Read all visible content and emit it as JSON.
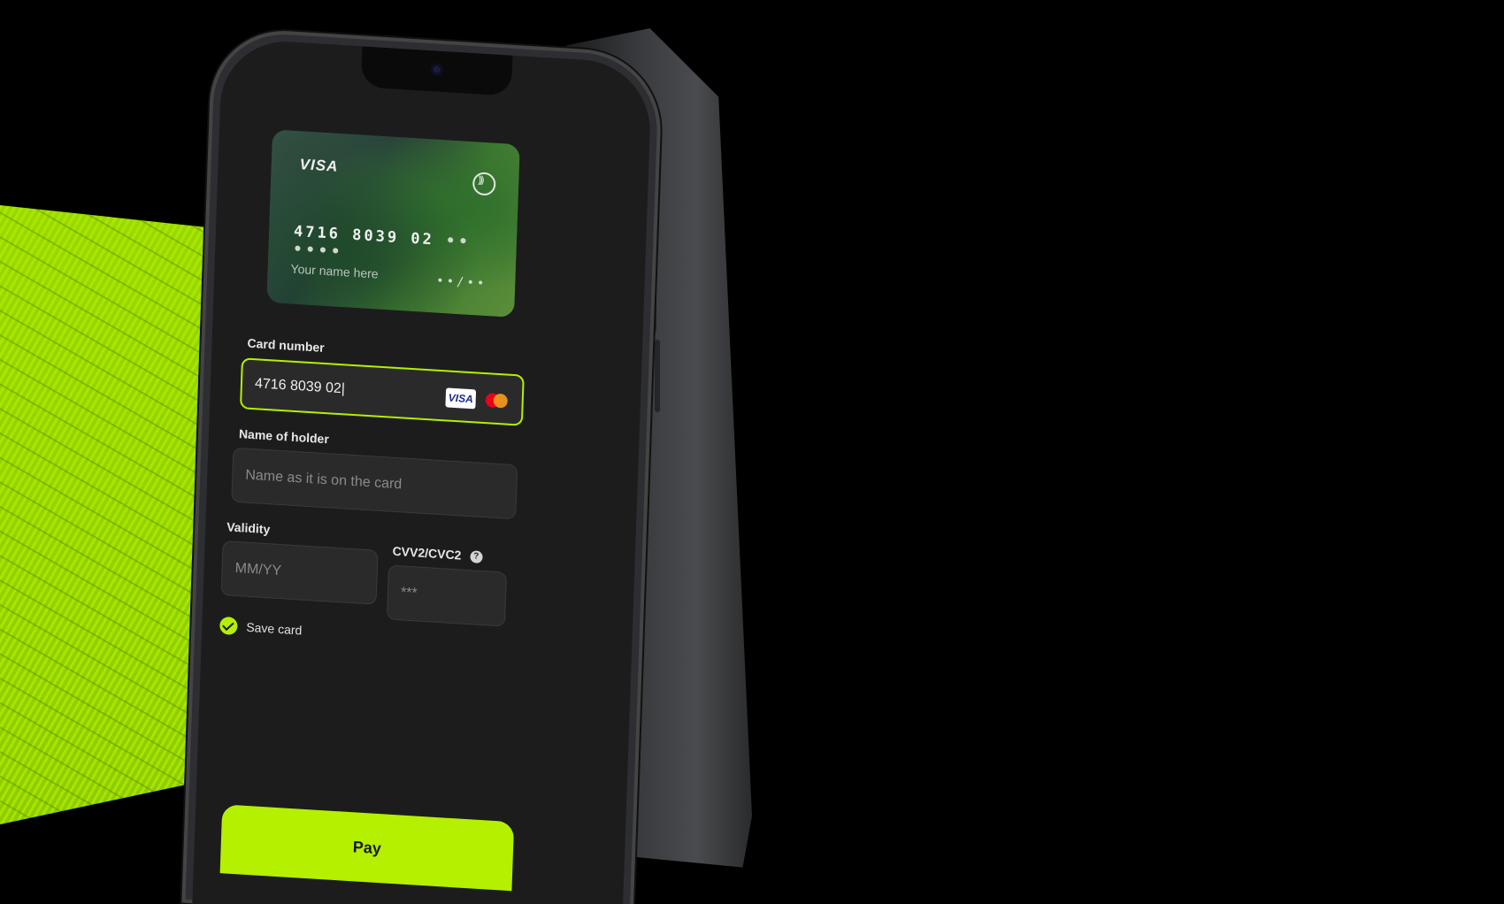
{
  "card_preview": {
    "brand": "VISA",
    "number_visible": "4716  8039  02",
    "number_masked": "••  ••••",
    "holder_placeholder": "Your name here",
    "expiry_masked": "••/••",
    "nfc_icon": "contactless-icon"
  },
  "form": {
    "card_number": {
      "label": "Card number",
      "value": "4716 8039 02|",
      "logos": [
        "VISA",
        "mastercard"
      ]
    },
    "holder": {
      "label": "Name of holder",
      "placeholder": "Name as it is on the card"
    },
    "validity": {
      "label": "Validity",
      "placeholder": "MM/YY"
    },
    "cvv": {
      "label": "CVV2/CVC2",
      "placeholder": "***",
      "help_icon": "?"
    },
    "save_card": {
      "label": "Save card",
      "checked": true
    }
  },
  "pay_button": {
    "label": "Pay"
  },
  "colors": {
    "accent": "#b4f000",
    "screen_bg": "#1c1c1d",
    "field_bg": "#2a2a2b"
  }
}
